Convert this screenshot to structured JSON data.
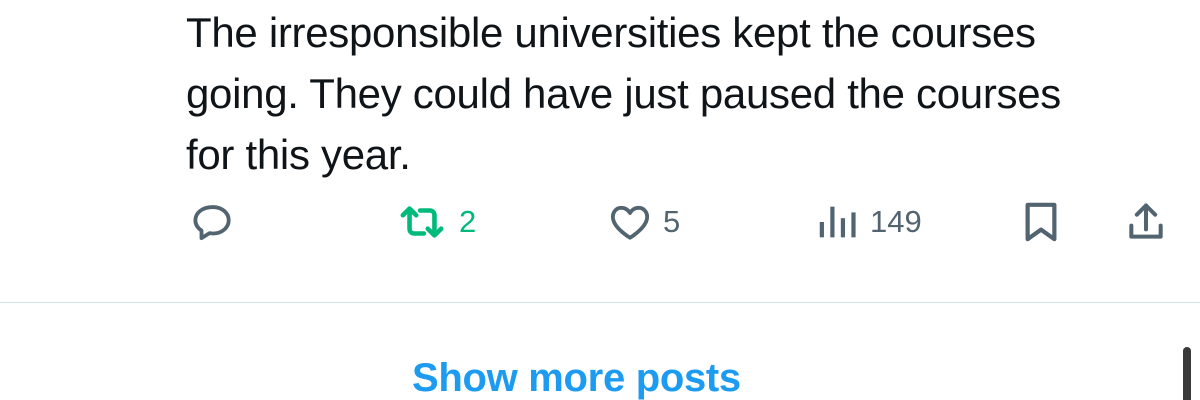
{
  "post": {
    "text": "The irresponsible universities kept the courses\ngoing.  They could have just paused the courses\nfor this year."
  },
  "actions": {
    "reply": {
      "icon": "reply-icon",
      "count": ""
    },
    "repost": {
      "icon": "repost-icon",
      "count": "2",
      "color": "#00ba7c"
    },
    "like": {
      "icon": "heart-icon",
      "count": "5"
    },
    "views": {
      "icon": "views-icon",
      "count": "149"
    },
    "bookmark": {
      "icon": "bookmark-icon"
    },
    "share": {
      "icon": "share-icon"
    }
  },
  "colors": {
    "text": "#0f1419",
    "muted": "#536471",
    "accent": "#1d9bf0"
  },
  "feed": {
    "show_more_label": "Show more posts"
  }
}
